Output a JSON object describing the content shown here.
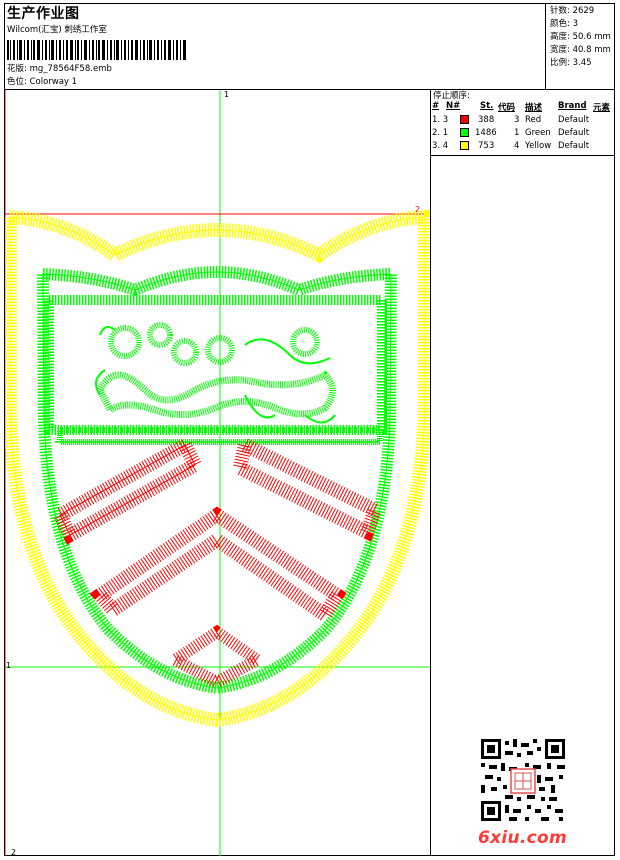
{
  "header": {
    "title": "生产作业图",
    "company": "Wilcom(汇宝) 刺绣工作室",
    "pattern_label": "花版:",
    "pattern_file": "mg_78564F58.emb",
    "colorway_label": "色位:",
    "colorway": "Colorway 1"
  },
  "stats": {
    "stitches_label": "针数:",
    "stitches": "2629",
    "colors_label": "颜色:",
    "colors": "3",
    "height_label": "高度:",
    "height": "50.6 mm",
    "width_label": "宽度:",
    "width": "40.8 mm",
    "scale_label": "比例:",
    "scale": "3.45"
  },
  "stop_sequence": {
    "title": "停止顺序:",
    "headers": [
      "#",
      "N#",
      "St.",
      "代码",
      "描述",
      "Brand",
      "元素"
    ],
    "rows": [
      {
        "idx": "1. 3",
        "color": "#ff0000",
        "stitches": "388",
        "code": "3",
        "desc": "Red",
        "brand": "Default"
      },
      {
        "idx": "2. 1",
        "color": "#00ff00",
        "stitches": "1486",
        "code": "1",
        "desc": "Green",
        "brand": "Default"
      },
      {
        "idx": "3. 4",
        "color": "#ffff00",
        "stitches": "753",
        "code": "4",
        "desc": "Yellow",
        "brand": "Default"
      }
    ]
  },
  "guides": {
    "top_label": "1",
    "right_label": "2",
    "left_label": "1",
    "bottom_label": "2"
  },
  "watermark": {
    "site": "6xiu.com"
  },
  "colors": {
    "red": "#ff0000",
    "green": "#00ff00",
    "yellow": "#ffff00"
  }
}
